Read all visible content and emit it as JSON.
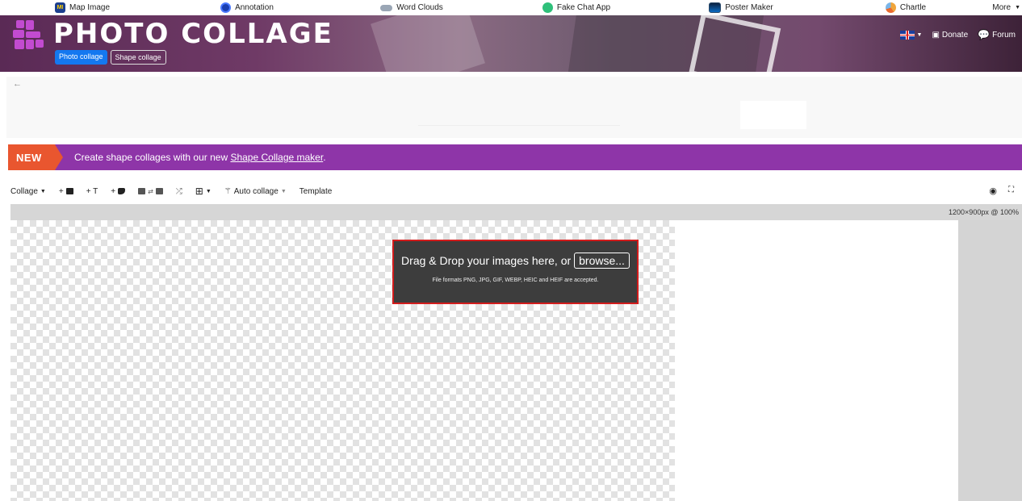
{
  "topnav": {
    "items": [
      {
        "label": "Map Image",
        "icon": "map-image-logo-icon"
      },
      {
        "label": "Annotation",
        "icon": "annotation-logo-icon"
      },
      {
        "label": "Word Clouds",
        "icon": "word-clouds-logo-icon"
      },
      {
        "label": "Fake Chat App",
        "icon": "fake-chat-logo-icon"
      },
      {
        "label": "Poster Maker",
        "icon": "poster-maker-logo-icon"
      },
      {
        "label": "Chartle",
        "icon": "chartle-logo-icon"
      }
    ],
    "more_label": "More",
    "mi_text": "MI"
  },
  "banner": {
    "title": "PHOTO COLLAGE",
    "tabs": [
      "Photo collage",
      "Shape collage"
    ],
    "donate_label": "Donate",
    "forum_label": "Forum"
  },
  "promo": {
    "tag": "NEW",
    "text": "Create shape collages with our new ",
    "link": "Shape Collage maker",
    "suffix": "."
  },
  "toolbar": {
    "collage_label": "Collage",
    "add_text_label": "+ T",
    "auto_collage_label": "Auto collage",
    "template_label": "Template"
  },
  "editor": {
    "size_info": "1200×900px @ 100%"
  },
  "dropzone": {
    "main_text": "Drag & Drop your images here, or",
    "browse_label": "browse...",
    "sub_text": "File formats PNG, JPG, GIF, WEBP, HEIC and HEIF are accepted."
  },
  "colors": {
    "accent_blue": "#1478f0",
    "promo_purple": "#8e35a8",
    "new_orange": "#e9562f",
    "dropzone_border": "#d21c1c"
  }
}
